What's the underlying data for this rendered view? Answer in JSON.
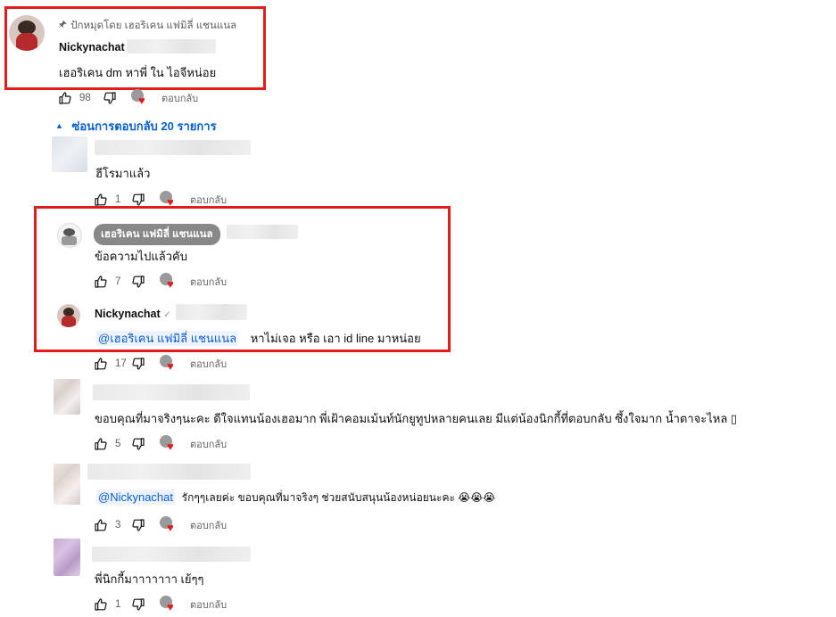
{
  "pinned": {
    "pin_text": "ปักหมุดโดย เฮอริเคน แฟมิลี่ แชนแนล",
    "author": "Nickynachat",
    "text": "เฮอริเคน dm หาพี่ ใน ไอจีหน่อย",
    "likes": "98",
    "reply_label": "ตอบกลับ"
  },
  "replies_toggle": "ซ่อนการตอบกลับ 20 รายการ",
  "comments": [
    {
      "text": "ฮีโรมาแล้ว",
      "likes": "1",
      "reply_label": "ตอบกลับ"
    },
    {
      "badge": "เฮอริเคน แฟมิลี่ แชนแนล",
      "text": "ข้อความไปแล้วคับ",
      "likes": "7",
      "reply_label": "ตอบกลับ"
    },
    {
      "author": "Nickynachat",
      "verified": "✓",
      "mention": "@เฮอริเคน แฟมิลี่ แชนแนล",
      "text": "หาไม่เจอ หรือ เอา id line มาหน่อย",
      "likes": "17",
      "reply_label": "ตอบกลับ"
    },
    {
      "text": "ขอบคุณที่มาจริงๆนะคะ ดีใจแทนน้องเฮอมาก พี่เฝ้าคอมเม้นท์นักยูทูปหลายคนเลย มีแต่น้องนิกกี้ที่ตอบกลับ ซึ้งใจมาก น้ำตาจะไหล ▯",
      "likes": "5",
      "reply_label": "ตอบกลับ"
    },
    {
      "mention": "@Nickynachat",
      "text": "รักๆๆเลยค่ะ ขอบคุณที่มาจริงๆ ช่วยสนับสนุนน้องหน่อยนะคะ 😭😭😭",
      "likes": "3",
      "reply_label": "ตอบกลับ"
    },
    {
      "text": "พี่นิกกี้มาาาาาาา เย้ๆๆ",
      "likes": "1",
      "reply_label": "ตอบกลับ"
    }
  ],
  "colors": {
    "highlight": "#e41b1b",
    "link": "#065fd4",
    "heart": "#e41b1b"
  }
}
